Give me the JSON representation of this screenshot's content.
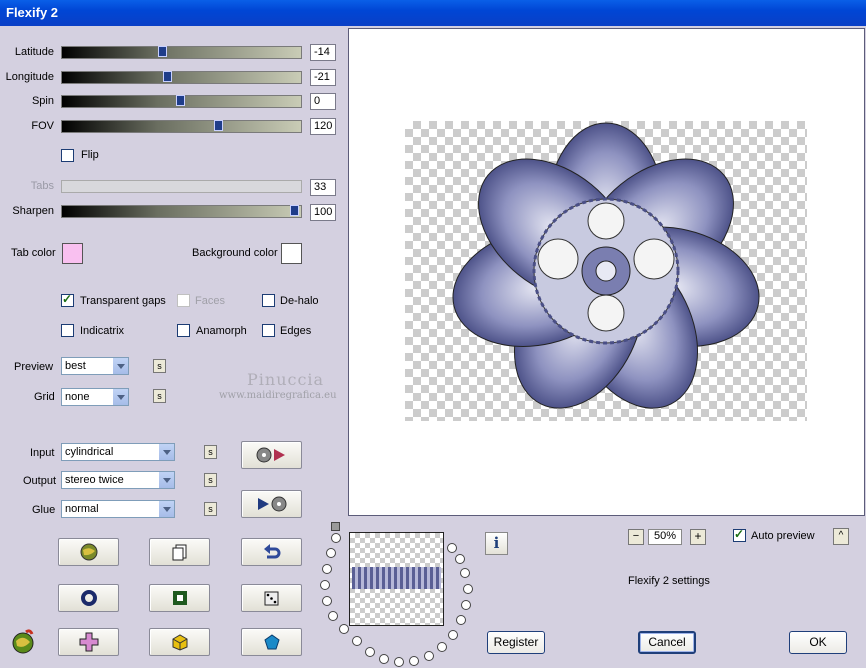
{
  "window": {
    "title": "Flexify 2"
  },
  "sliders": [
    {
      "label": "Latitude",
      "value": "-14",
      "level": 0.43,
      "enabled": true
    },
    {
      "label": "Longitude",
      "value": "-21",
      "level": 0.45,
      "enabled": true
    },
    {
      "label": "Spin",
      "value": "0",
      "level": 0.5,
      "enabled": true
    },
    {
      "label": "FOV",
      "value": "120",
      "level": 0.66,
      "enabled": true
    }
  ],
  "flip": {
    "label": "Flip",
    "checked": false
  },
  "tabs": {
    "label": "Tabs",
    "value": "33"
  },
  "sharpen": {
    "label": "Sharpen",
    "value": "100",
    "level": 1.0
  },
  "tab_color": {
    "label": "Tab color",
    "color": "#f9c0f0"
  },
  "background_color": {
    "label": "Background color",
    "color": "#ffffff"
  },
  "options": {
    "transparent_gaps": {
      "label": "Transparent gaps",
      "checked": true
    },
    "faces": {
      "label": "Faces",
      "checked": false
    },
    "de_halo": {
      "label": "De-halo",
      "checked": false
    },
    "indicatrix": {
      "label": "Indicatrix",
      "checked": false
    },
    "anamorph": {
      "label": "Anamorph",
      "checked": false
    },
    "edges": {
      "label": "Edges",
      "checked": false
    }
  },
  "preview_select": {
    "label": "Preview",
    "value": "best"
  },
  "grid_select": {
    "label": "Grid",
    "value": "none"
  },
  "watermark": {
    "line1": "Pinuccia",
    "line2": "www.maidiregrafica.eu"
  },
  "input_select": {
    "label": "Input",
    "value": "cylindrical"
  },
  "output_select": {
    "label": "Output",
    "value": "stereo twice"
  },
  "glue_select": {
    "label": "Glue",
    "value": "normal"
  },
  "s_label": "s",
  "zoom": {
    "value": "50%",
    "minus": "−",
    "plus": "+"
  },
  "auto_preview": {
    "label": "Auto preview",
    "checked": true,
    "button": "^"
  },
  "settings_text": "Flexify 2 settings",
  "info_label": "i",
  "buttons": {
    "register": "Register",
    "cancel": "Cancel",
    "ok": "OK"
  },
  "colors": {
    "accent": "#1f3f7a",
    "titlebar": "#0046d5",
    "flower": "#6b70a8"
  }
}
